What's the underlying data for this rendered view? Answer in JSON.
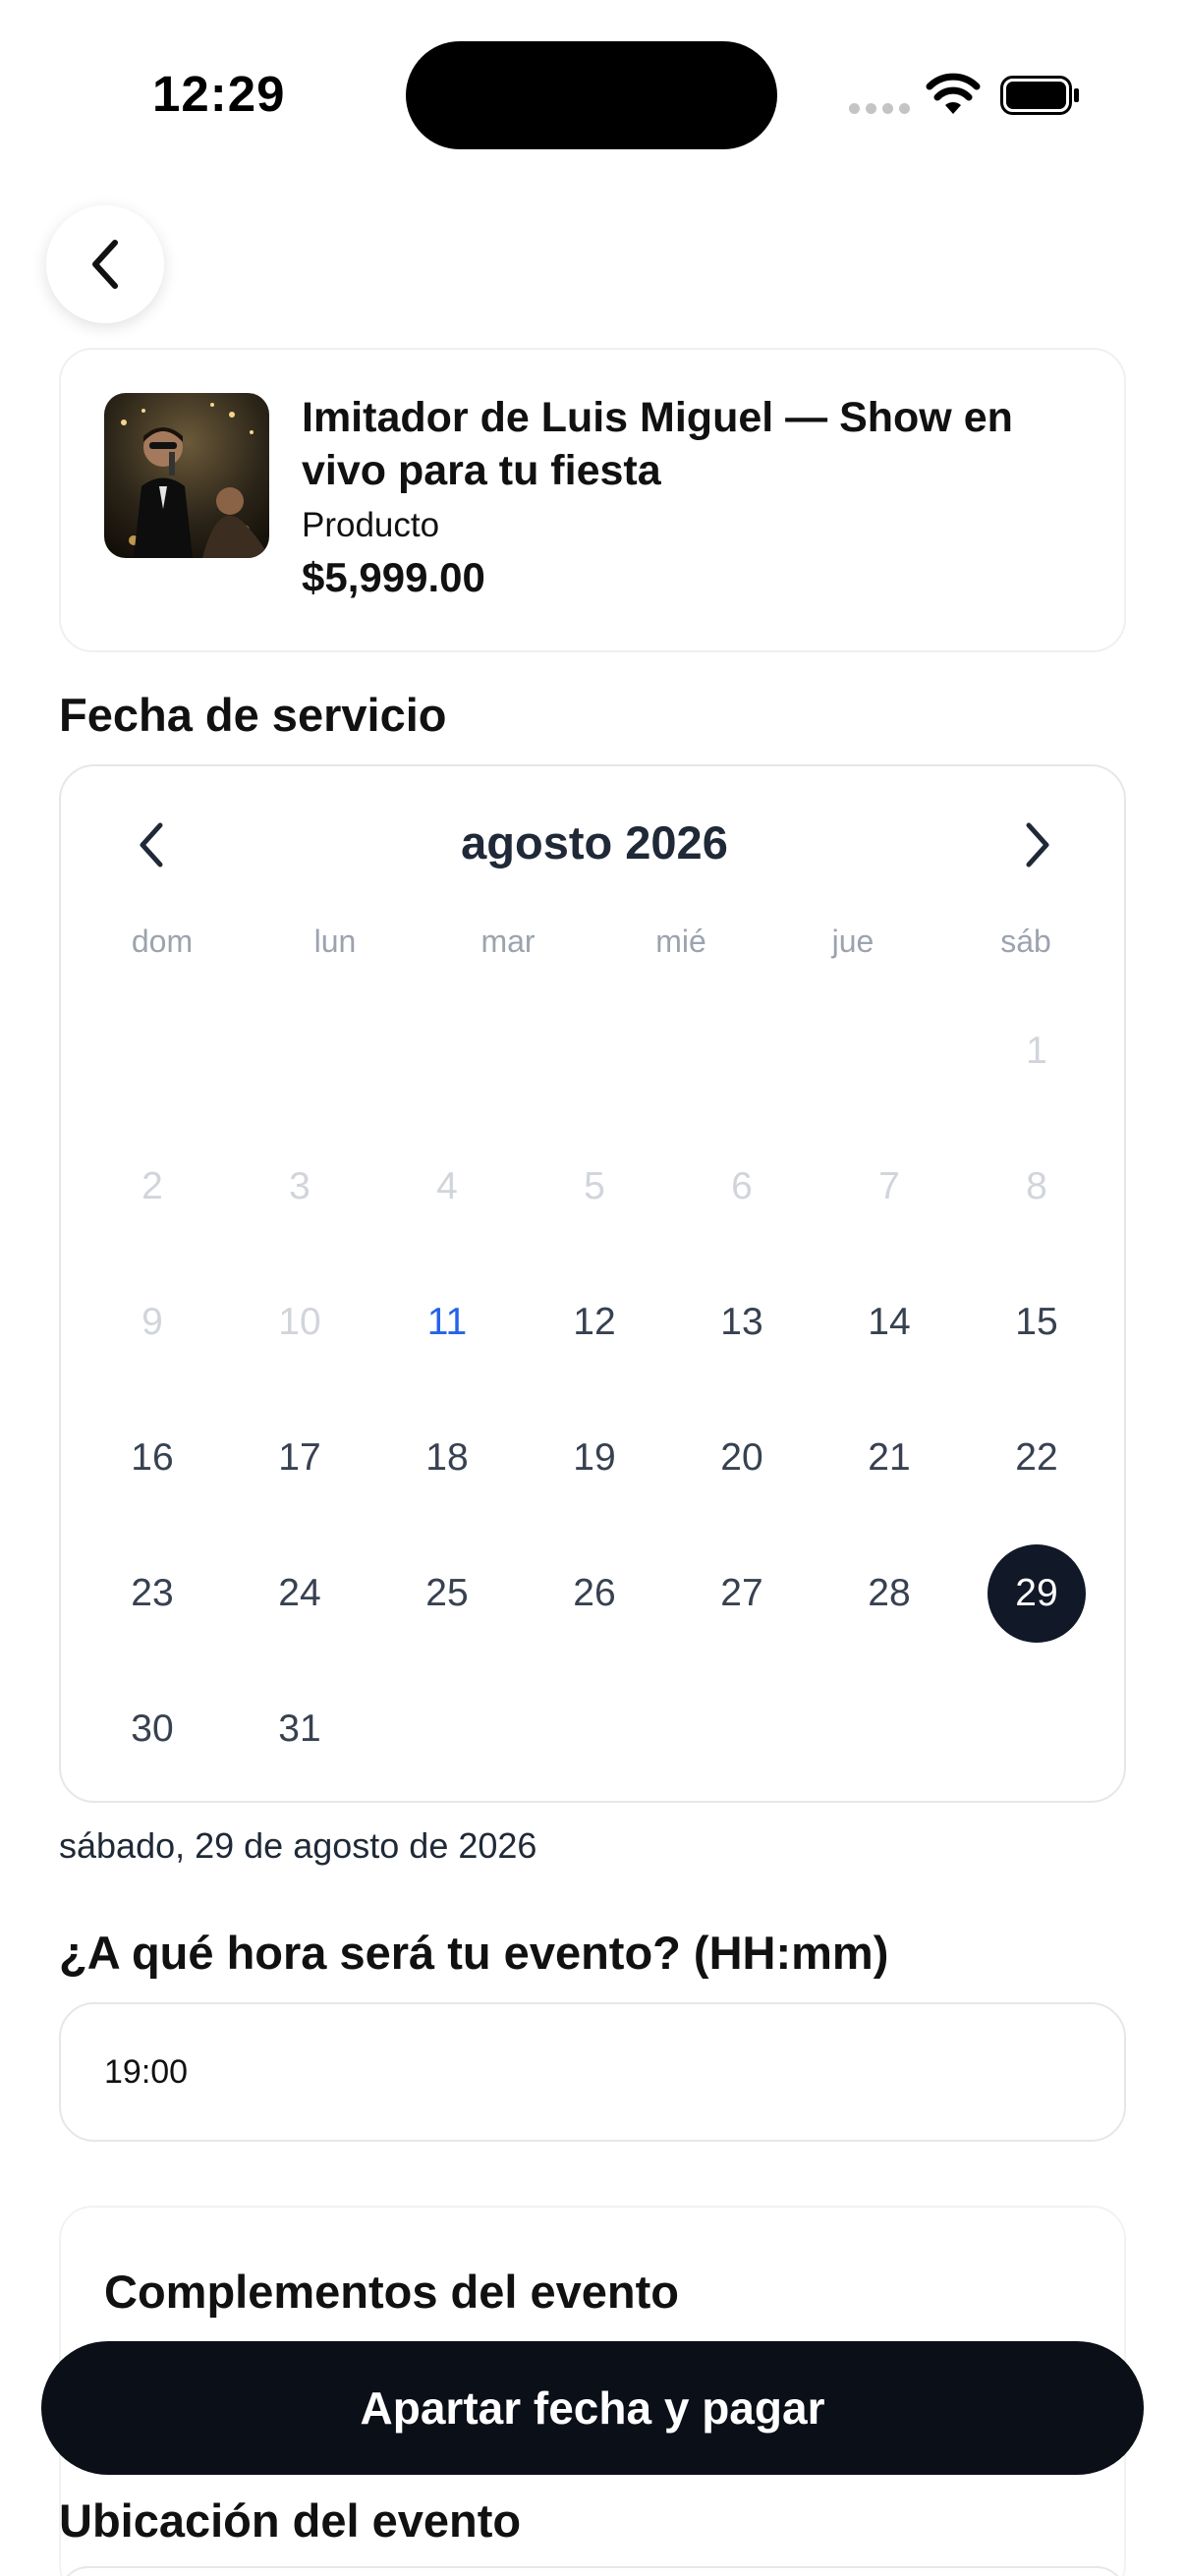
{
  "status_bar": {
    "time": "12:29"
  },
  "header": {
    "back_icon": "chevron-left-icon"
  },
  "product": {
    "title": "Imitador de Luis Miguel — Show en vivo para tu fiesta",
    "type": "Producto",
    "price": "$5,999.00"
  },
  "service_date": {
    "label": "Fecha de servicio"
  },
  "calendar": {
    "month_label": "agosto 2026",
    "weekdays": [
      "dom",
      "lun",
      "mar",
      "mié",
      "jue",
      "sáb"
    ],
    "first_weekday_index": 6,
    "days_in_month": 31,
    "disabled_until": 10,
    "today": 11,
    "selected": 29
  },
  "selected_date_text": "sábado, 29 de agosto de 2026",
  "event_time": {
    "label": "¿A qué hora será tu evento? (HH:mm)",
    "value": "19:00"
  },
  "complements": {
    "title": "Complementos del evento"
  },
  "cta": {
    "label": "Apartar fecha y pagar"
  },
  "location": {
    "label": "Ubicación del evento"
  },
  "colors": {
    "primary": "#0b0f17",
    "today": "#2563eb",
    "selected_bg": "#111827"
  }
}
